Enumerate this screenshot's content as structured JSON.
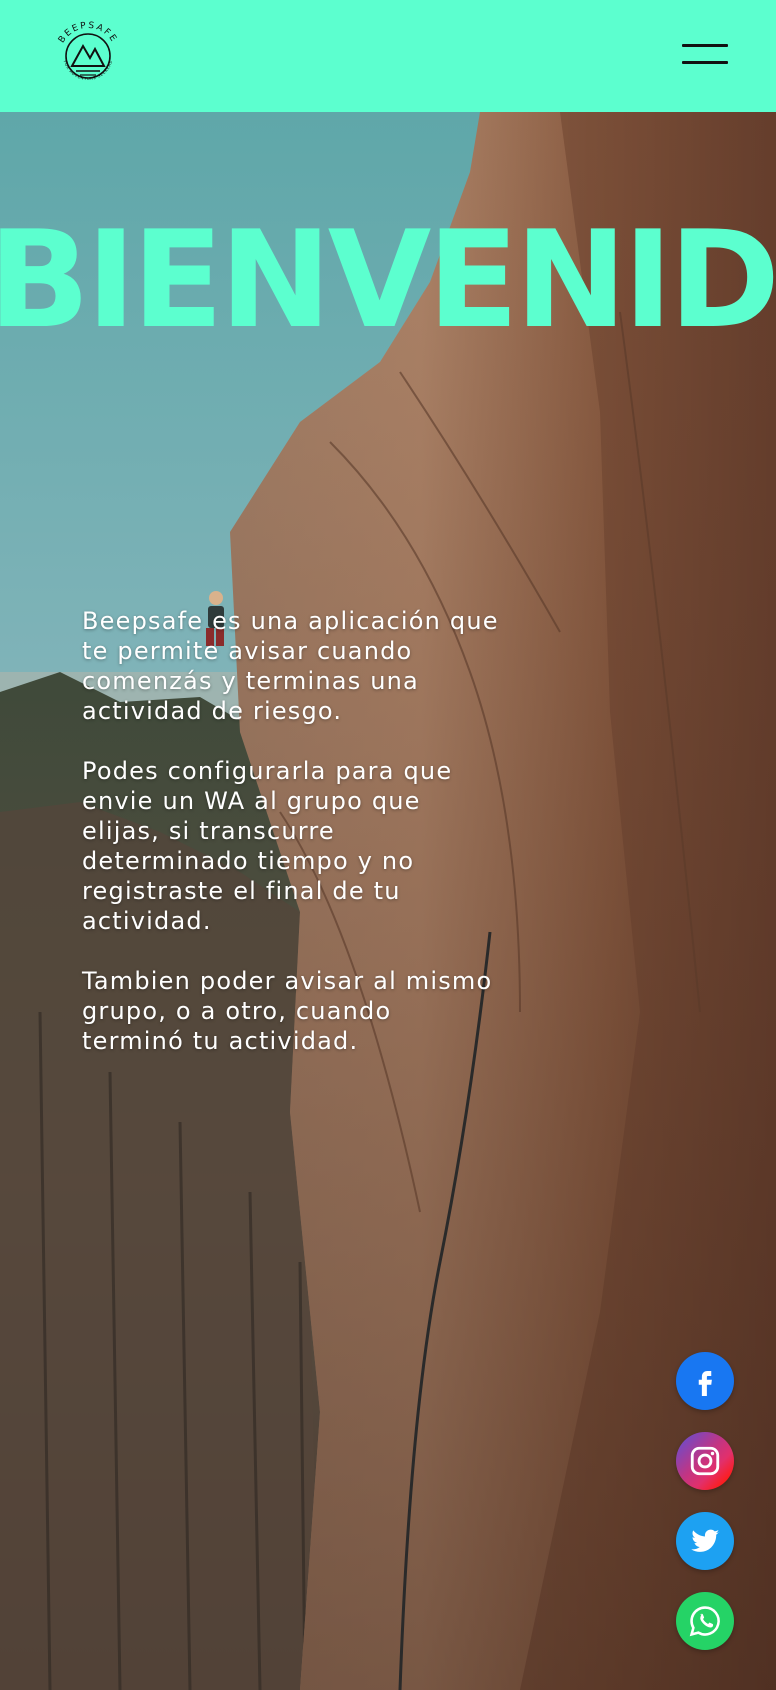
{
  "header": {
    "logo_alt": "BEEPSAFE",
    "logo_brand": "BEEPSAFE",
    "logo_tagline": "FOR ADVENTURE SEEKERS",
    "menu_icon": "hamburger-menu-icon",
    "background_color": "#5cffcf"
  },
  "hero": {
    "title": "BIENVENIDO",
    "title_color": "#5cffcf",
    "paragraphs": [
      "Beepsafe es una aplicación que te permite avisar cuando comenzás y terminas una actividad de riesgo.",
      "Podes configurarla para que envie un WA al grupo que elijas, si transcurre determinado tiempo y no registraste el final de tu actividad.",
      "Tambien poder avisar al mismo grupo, o a otro, cuando terminó tu actividad."
    ]
  },
  "social": [
    {
      "name": "facebook",
      "icon": "facebook-icon",
      "color": "#1877f2"
    },
    {
      "name": "instagram",
      "icon": "instagram-icon",
      "color": "#c13584"
    },
    {
      "name": "twitter",
      "icon": "twitter-icon",
      "color": "#1da1f2"
    },
    {
      "name": "whatsapp",
      "icon": "whatsapp-icon",
      "color": "#25d366"
    }
  ]
}
